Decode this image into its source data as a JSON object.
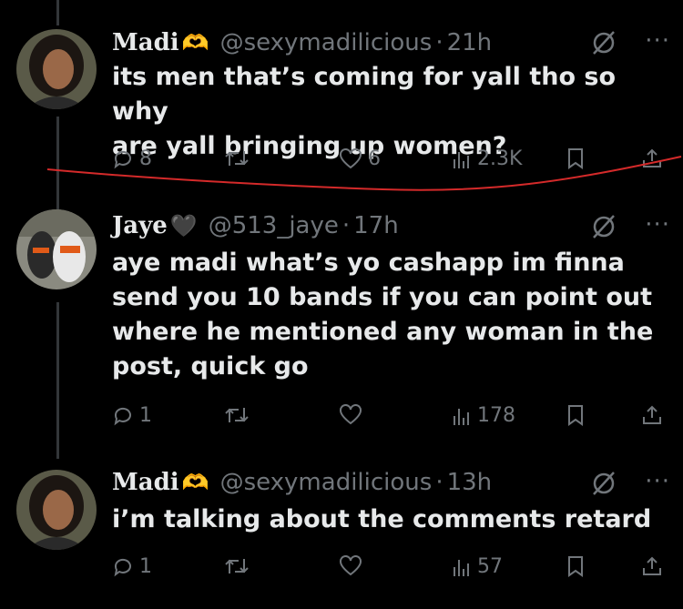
{
  "tweets": [
    {
      "name": "Madi",
      "name_emoji": "🫶",
      "handle": "@sexymadilicious",
      "time": "21h",
      "text_lines": [
        "its men that’s coming for yall tho so why",
        "are yall bringing up women?"
      ],
      "replies": "8",
      "retweets": "",
      "likes": "6",
      "views": "2.3K"
    },
    {
      "name": "Jaye",
      "name_emoji": "🖤",
      "handle": "@513_jaye",
      "time": "17h",
      "text_lines": [
        "aye madi what’s yo cashapp im finna",
        "send you 10 bands if you can point out",
        "where he mentioned any woman in the",
        "post, quick go"
      ],
      "replies": "1",
      "retweets": "",
      "likes": "",
      "views": "178"
    },
    {
      "name": "Madi",
      "name_emoji": "🫶",
      "handle": "@sexymadilicious",
      "time": "13h",
      "text_lines": [
        "i’m talking about the comments retard"
      ],
      "replies": "1",
      "retweets": "",
      "likes": "",
      "views": "57"
    }
  ],
  "colors": {
    "background": "#000000",
    "text": "#e7e9ea",
    "muted": "#71767b",
    "annotation": "#d42a2a"
  },
  "icons": [
    "reply-icon",
    "retweet-icon",
    "like-icon",
    "views-icon",
    "bookmark-icon",
    "share-icon",
    "grok-icon",
    "more-icon"
  ]
}
